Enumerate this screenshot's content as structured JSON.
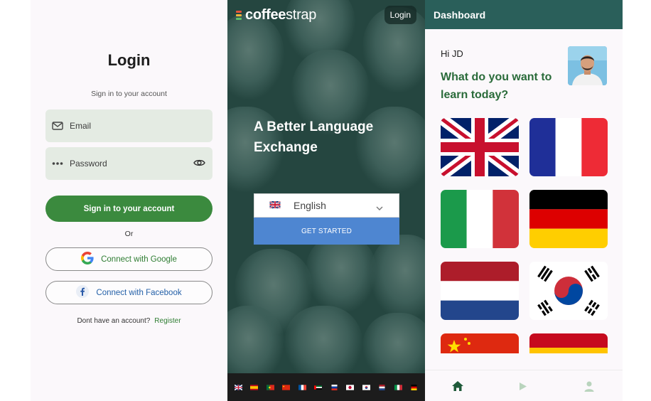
{
  "login": {
    "title": "Login",
    "subtitle": "Sign in to your account",
    "email_placeholder": "Email",
    "password_placeholder": "Password",
    "submit_label": "Sign in to your account",
    "or_label": "Or",
    "google_label": "Connect with Google",
    "facebook_label": "Connect with Facebook",
    "no_account_text": "Dont have an account?",
    "register_label": "Register"
  },
  "landing": {
    "brand_part1": "coffee",
    "brand_part2": "strap",
    "login_label": "Login",
    "headline": "A Better Language Exchange",
    "selected_language": "English",
    "get_started_label": "GET STARTED",
    "flag_icons": [
      "uk-flag-icon",
      "spain-flag-icon",
      "portugal-flag-icon",
      "china-flag-icon",
      "france-flag-icon",
      "uae-flag-icon",
      "russia-flag-icon",
      "japan-flag-icon",
      "korea-flag-icon",
      "netherlands-flag-icon",
      "italy-flag-icon",
      "germany-flag-icon"
    ]
  },
  "dashboard": {
    "title": "Dashboard",
    "greeting": "Hi JD",
    "question": "What do you want to learn today?",
    "languages": [
      "English",
      "French",
      "Italian",
      "German",
      "Dutch",
      "Korean",
      "Chinese",
      "Spanish"
    ],
    "nav": [
      "home-icon",
      "play-icon",
      "profile-icon"
    ]
  },
  "colors": {
    "primary_green": "#3b8a3e",
    "teal_header": "#2a5f5a",
    "blue_button": "#4e86d1",
    "question_green": "#2a6b3a"
  }
}
